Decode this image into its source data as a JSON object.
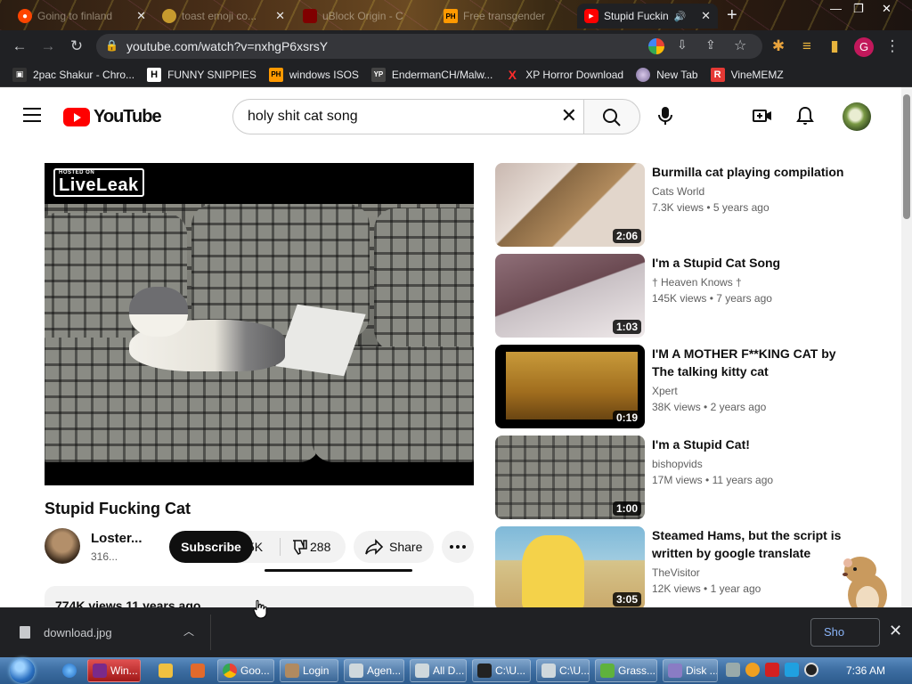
{
  "browser": {
    "tabs": [
      {
        "title": "Going to finland",
        "active": false
      },
      {
        "title": "toast emoji co...",
        "active": false
      },
      {
        "title": "uBlock Origin - C",
        "active": false
      },
      {
        "title": "Free transgender",
        "active": false
      },
      {
        "title": "Stupid Fuckin",
        "active": true
      }
    ],
    "url": "youtube.com/watch?v=nxhgP6xsrsY",
    "profile_initial": "G",
    "bookmarks": [
      {
        "label": "2pac Shakur - Chro...",
        "icon": "H"
      },
      {
        "label": "FUNNY SNIPPIES",
        "icon": "H"
      },
      {
        "label": "windows ISOS",
        "icon": "PH"
      },
      {
        "label": "EndermanCH/Malw...",
        "icon": "YP"
      },
      {
        "label": "XP Horror Download",
        "icon": "X"
      },
      {
        "label": "New Tab",
        "icon": "globe"
      },
      {
        "label": "VineMEMZ",
        "icon": "R"
      }
    ]
  },
  "youtube": {
    "logo_text": "YouTube",
    "search_query": "holy shit cat song",
    "video": {
      "watermark": "LiveLeak",
      "watermark_sub": "HOSTED ON",
      "title": "Stupid Fucking Cat",
      "channel": "Loster...",
      "subscribers": "316...",
      "subscribe_label": "Subscribe",
      "likes": "5K",
      "dislikes": "288",
      "share_label": "Share",
      "views_date": "774K views  11 years ago"
    },
    "recommendations": [
      {
        "title": "Burmilla cat playing compilation",
        "channel": "Cats World",
        "views": "7.3K views",
        "age": "5 years ago",
        "duration": "2:06"
      },
      {
        "title": "I'm a Stupid Cat Song",
        "channel": "† Heaven Knows †",
        "views": "145K views",
        "age": "7 years ago",
        "duration": "1:03"
      },
      {
        "title": "I'M A MOTHER F**KING CAT by The talking kitty cat",
        "channel": "Xpert",
        "views": "38K views",
        "age": "2 years ago",
        "duration": "0:19"
      },
      {
        "title": "I'm a Stupid Cat!",
        "channel": "bishopvids",
        "views": "17M views",
        "age": "11 years ago",
        "duration": "1:00"
      },
      {
        "title": "Steamed Hams, but the script is written by google translate",
        "channel": "TheVisitor",
        "views": "12K views",
        "age": "1 year ago",
        "duration": "3:05"
      }
    ]
  },
  "download_bar": {
    "filename": "download.jpg",
    "show_all_label": "Sho"
  },
  "taskbar": {
    "buttons": [
      "Win...",
      "Goo...",
      "Login",
      "Agen...",
      "All D...",
      "C:\\U...",
      "C:\\U...",
      "Grass...",
      "Disk ..."
    ],
    "clock": "7:36 AM"
  },
  "colors": {
    "yt_red": "#ff0000",
    "chrome_dark": "#202124",
    "taskbar_blue": "#3e6fa3"
  }
}
